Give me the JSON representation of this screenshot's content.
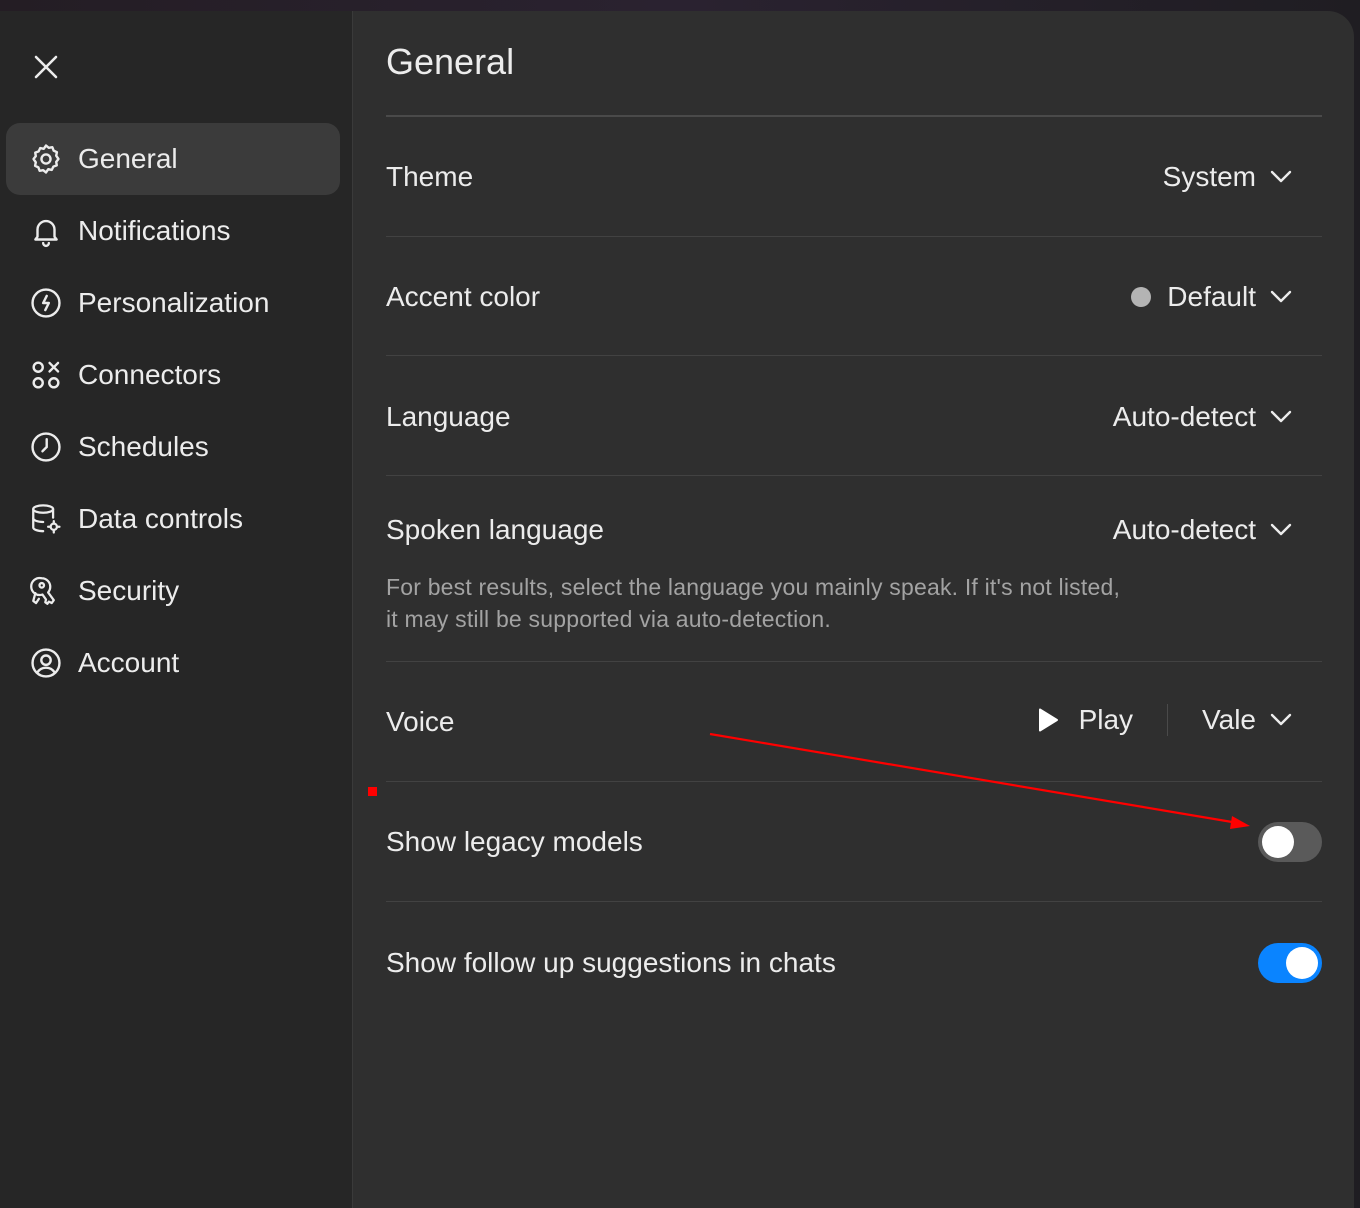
{
  "sidebar": {
    "items": [
      {
        "label": "General",
        "icon": "gear-icon",
        "active": true
      },
      {
        "label": "Notifications",
        "icon": "bell-icon",
        "active": false
      },
      {
        "label": "Personalization",
        "icon": "personalization-icon",
        "active": false
      },
      {
        "label": "Connectors",
        "icon": "connectors-icon",
        "active": false
      },
      {
        "label": "Schedules",
        "icon": "clock-icon",
        "active": false
      },
      {
        "label": "Data controls",
        "icon": "database-gear-icon",
        "active": false
      },
      {
        "label": "Security",
        "icon": "security-key-icon",
        "active": false
      },
      {
        "label": "Account",
        "icon": "user-circle-icon",
        "active": false
      }
    ]
  },
  "main": {
    "title": "General",
    "theme": {
      "label": "Theme",
      "value": "System"
    },
    "accent_color": {
      "label": "Accent color",
      "value": "Default",
      "swatch": "#b4b4b4"
    },
    "language": {
      "label": "Language",
      "value": "Auto-detect"
    },
    "spoken_language": {
      "label": "Spoken language",
      "value": "Auto-detect",
      "help_line1": "For best results, select the language you mainly speak. If it's not listed,",
      "help_line2": "it may still be supported via auto-detection."
    },
    "voice": {
      "label": "Voice",
      "play_label": "Play",
      "value": "Vale"
    },
    "legacy_models": {
      "label": "Show legacy models",
      "enabled": false
    },
    "follow_up": {
      "label": "Show follow up suggestions in chats",
      "enabled": true
    }
  },
  "colors": {
    "toggle_on": "#0a84ff",
    "annotation": "#ff0000"
  }
}
